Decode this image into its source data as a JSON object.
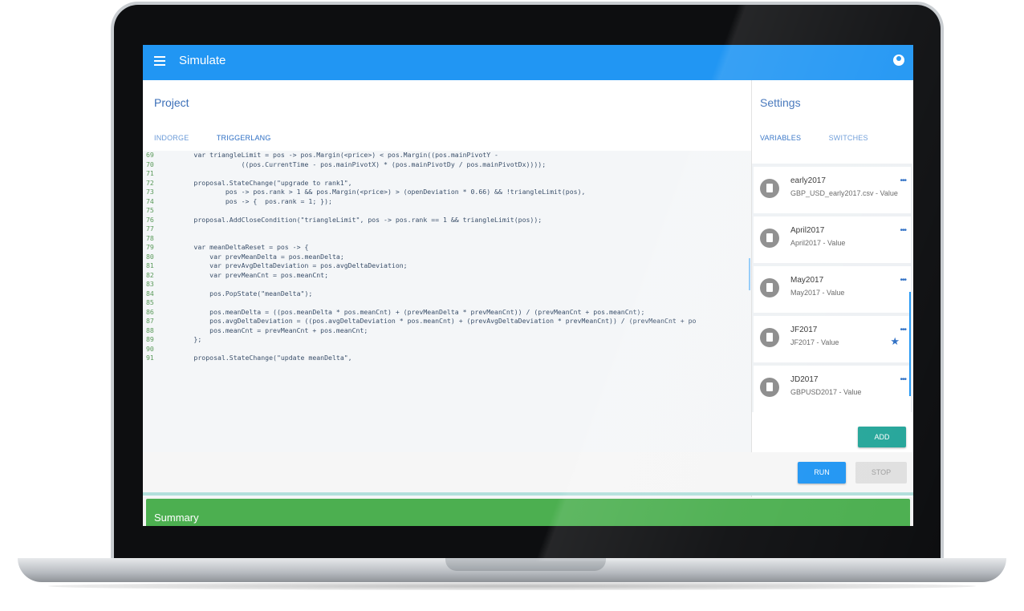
{
  "app": {
    "title": "Simulate"
  },
  "icons": {
    "menu": "menu-icon",
    "account": "account-circle-icon",
    "file": "file-icon",
    "more": "more-horiz-icon",
    "star": "star-icon"
  },
  "colors": {
    "appbar": "#2196f3",
    "add_button": "#26a69a",
    "run_button": "#2196f3",
    "summary": "#4caf50"
  },
  "project": {
    "title": "Project",
    "tabs": [
      {
        "label": "INDORGE",
        "active": false
      },
      {
        "label": "TRIGGERLANG",
        "active": true
      }
    ],
    "code": [
      {
        "n": "69",
        "t": "        var triangleLimit = pos -> pos.Margin(<price>) < pos.Margin((pos.mainPivotY -"
      },
      {
        "n": "70",
        "t": "                    ((pos.CurrentTime - pos.mainPivotX) * (pos.mainPivotDy / pos.mainPivotDx))));"
      },
      {
        "n": "71",
        "t": ""
      },
      {
        "n": "72",
        "t": "        proposal.StateChange(\"upgrade to rank1\","
      },
      {
        "n": "73",
        "t": "                pos -> pos.rank > 1 && pos.Margin(<price>) > (openDeviation * 0.66) && !triangleLimit(pos),"
      },
      {
        "n": "74",
        "t": "                pos -> {  pos.rank = 1; });"
      },
      {
        "n": "75",
        "t": ""
      },
      {
        "n": "76",
        "t": "        proposal.AddCloseCondition(\"triangleLimit\", pos -> pos.rank == 1 && triangleLimit(pos));"
      },
      {
        "n": "77",
        "t": ""
      },
      {
        "n": "78",
        "t": ""
      },
      {
        "n": "79",
        "t": "        var meanDeltaReset = pos -> {"
      },
      {
        "n": "80",
        "t": "            var prevMeanDelta = pos.meanDelta;"
      },
      {
        "n": "81",
        "t": "            var prevAvgDeltaDeviation = pos.avgDeltaDeviation;"
      },
      {
        "n": "82",
        "t": "            var prevMeanCnt = pos.meanCnt;"
      },
      {
        "n": "83",
        "t": ""
      },
      {
        "n": "84",
        "t": "            pos.PopState(\"meanDelta\");"
      },
      {
        "n": "85",
        "t": ""
      },
      {
        "n": "86",
        "t": "            pos.meanDelta = ((pos.meanDelta * pos.meanCnt) + (prevMeanDelta * prevMeanCnt)) / (prevMeanCnt + pos.meanCnt);"
      },
      {
        "n": "87",
        "t": "            pos.avgDeltaDeviation = ((pos.avgDeltaDeviation * pos.meanCnt) + (prevAvgDeltaDeviation * prevMeanCnt)) / (prevMeanCnt + po"
      },
      {
        "n": "88",
        "t": "            pos.meanCnt = prevMeanCnt + pos.meanCnt;"
      },
      {
        "n": "89",
        "t": "        };"
      },
      {
        "n": "90",
        "t": ""
      },
      {
        "n": "91",
        "t": "        proposal.StateChange(\"update meanDelta\","
      }
    ]
  },
  "settings": {
    "title": "Settings",
    "tabs": [
      {
        "label": "VARIABLES",
        "active": true
      },
      {
        "label": "SWITCHES",
        "active": false
      }
    ],
    "variables": [
      {
        "name": "early2017",
        "value": "GBP_USD_early2017.csv - Value",
        "starred": false
      },
      {
        "name": "April2017",
        "value": "April2017 - Value",
        "starred": false
      },
      {
        "name": "May2017",
        "value": "May2017 - Value",
        "starred": false
      },
      {
        "name": "JF2017",
        "value": "JF2017 - Value",
        "starred": true
      },
      {
        "name": "JD2017",
        "value": "GBPUSD2017 - Value",
        "starred": false
      }
    ],
    "more_label": "•••",
    "add_label": "ADD"
  },
  "actions": {
    "run_label": "RUN",
    "stop_label": "STOP"
  },
  "summary": {
    "title": "Summary"
  }
}
